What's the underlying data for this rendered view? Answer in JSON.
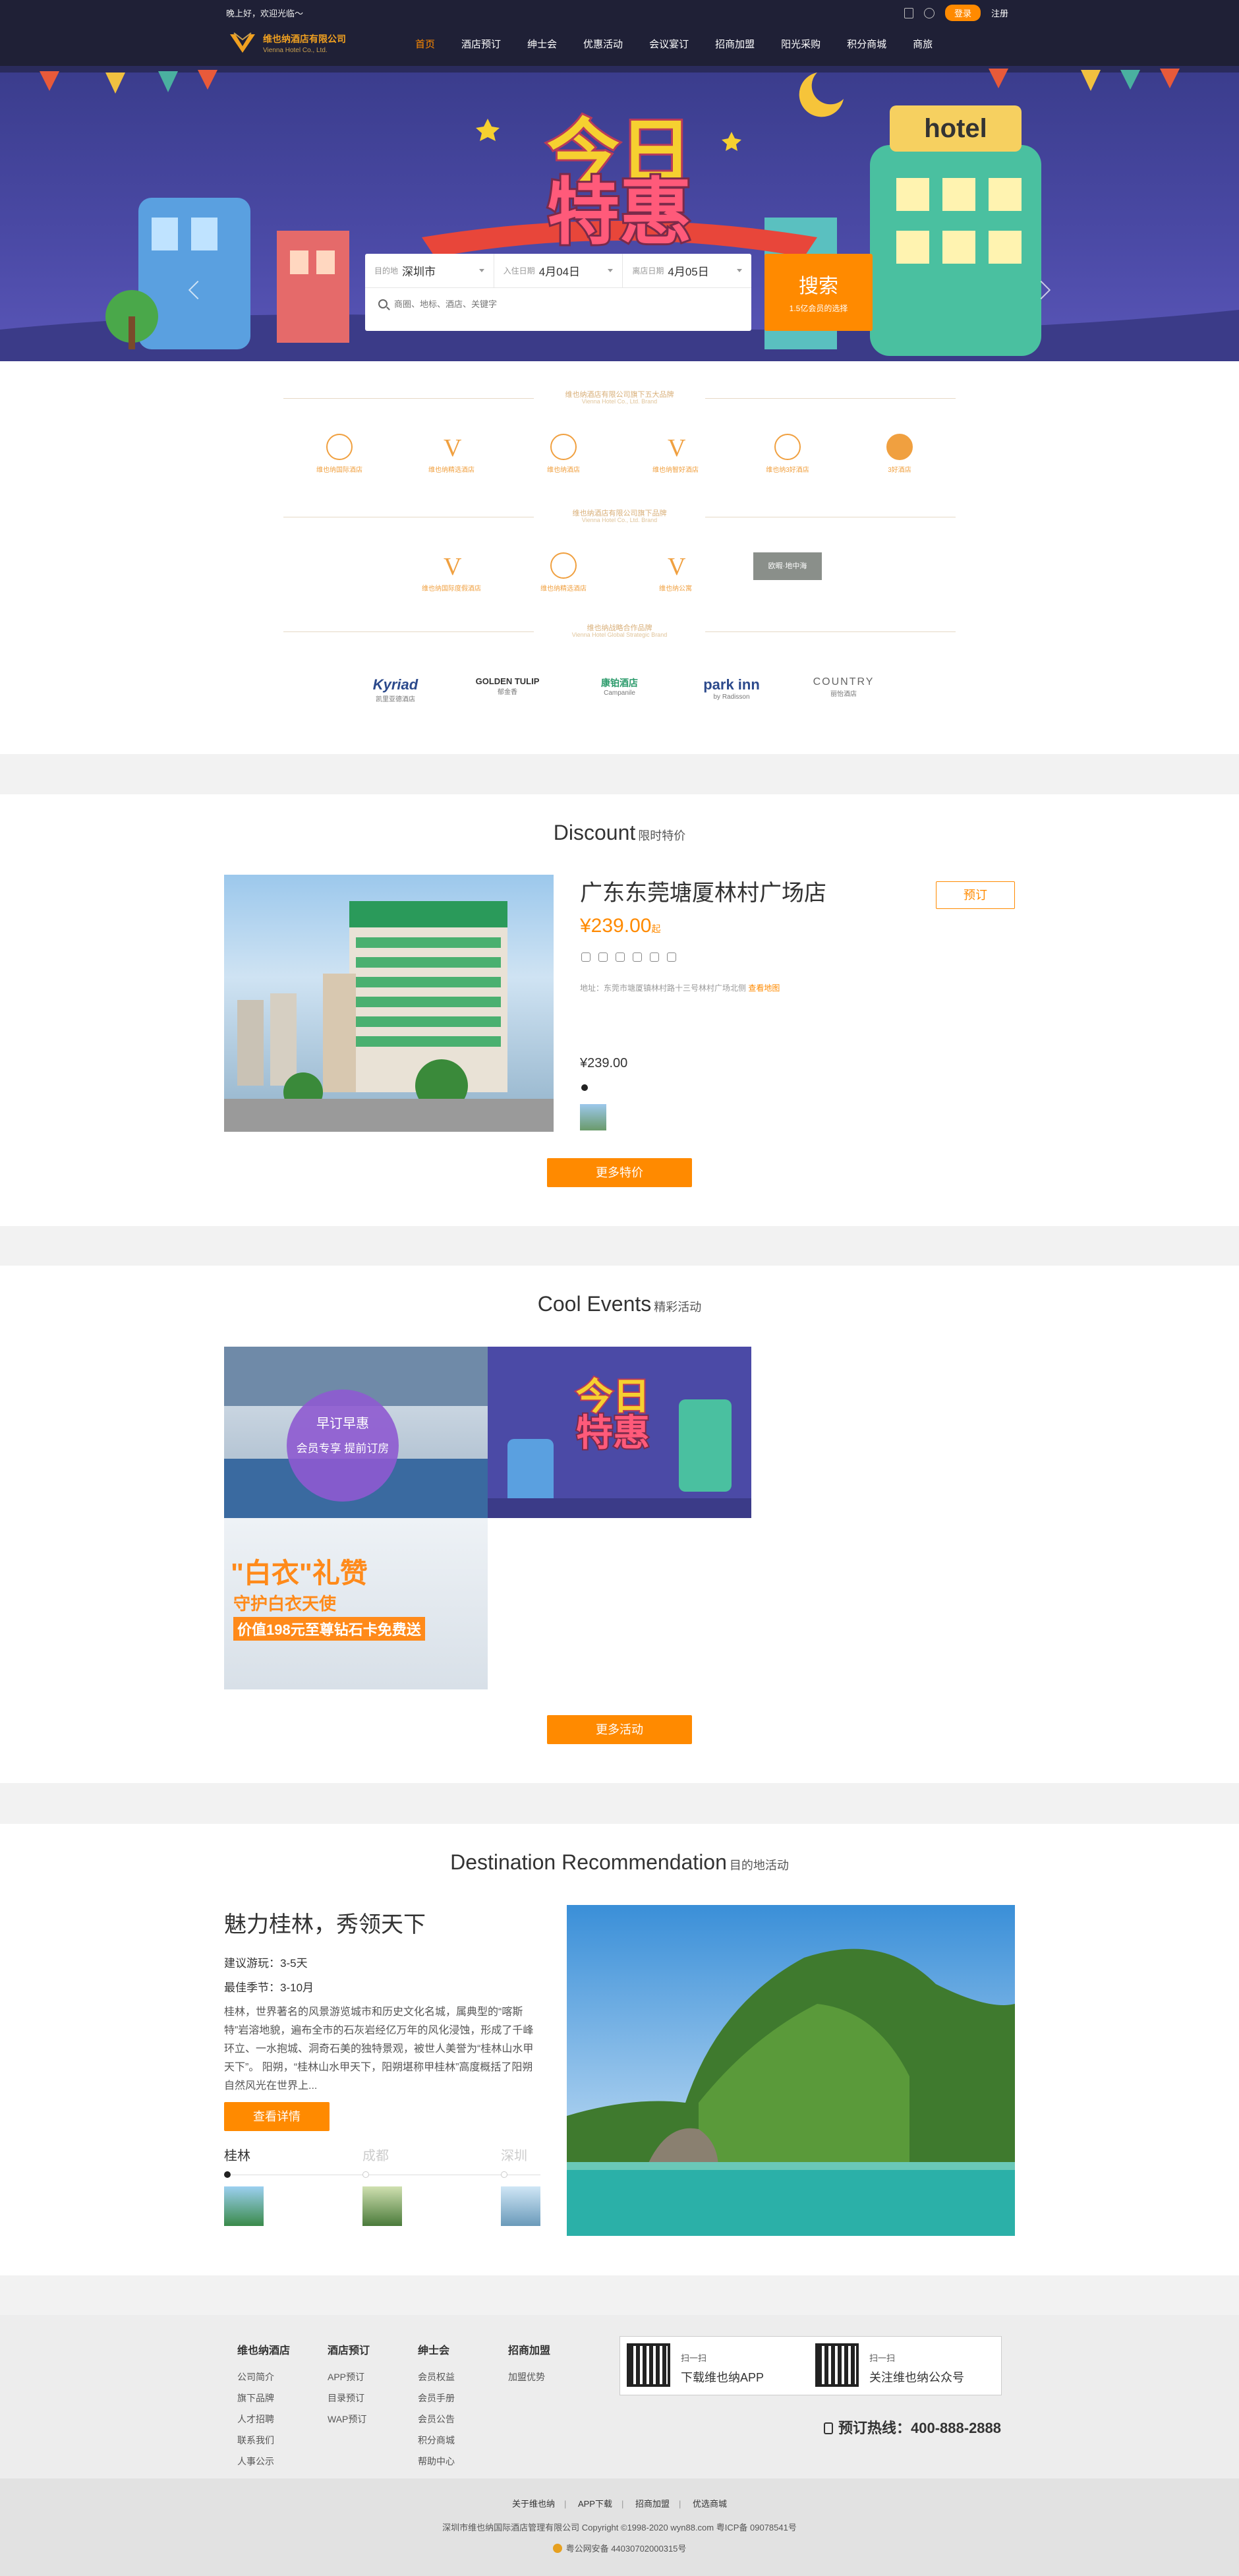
{
  "topbar": {
    "welcome": "晚上好，欢迎光临～",
    "login": "登录",
    "register": "注册"
  },
  "logo": {
    "cn": "维也纳酒店有限公司",
    "en": "Vienna Hotel Co., Ltd."
  },
  "nav": [
    "首页",
    "酒店预订",
    "绅士会",
    "优惠活动",
    "会议宴订",
    "招商加盟",
    "阳光采购",
    "积分商城",
    "商旅"
  ],
  "search": {
    "dest_label": "目的地",
    "dest_value": "深圳市",
    "checkin_label": "入住日期",
    "checkin_value": "4月04日",
    "checkout_label": "离店日期",
    "checkout_value": "4月05日",
    "keyword_placeholder": "商圈、地标、酒店、关键字",
    "button": "搜索",
    "button_sub": "1.5亿会员的选择"
  },
  "brands": {
    "group1_title": "维也纳酒店有限公司旗下五大品牌",
    "group1_en": "Vienna Hotel Co., Ltd. Brand",
    "group1": [
      "维也纳国际酒店",
      "维也纳精选酒店",
      "维也纳酒店",
      "维也纳智好酒店",
      "维也纳3好酒店",
      "3好酒店"
    ],
    "group2_title": "维也纳酒店有限公司旗下品牌",
    "group2_en": "Vienna Hotel Co., Ltd. Brand",
    "group2": [
      "维也纳国际度假酒店",
      "维也纳精选酒店",
      "维也纳公寓"
    ],
    "group2_gray": "欧暇·地中海",
    "group3_title": "维也纳战略合作品牌",
    "group3_en": "Vienna Hotel Global Strategic Brand",
    "partners": [
      {
        "name": "Kyriad",
        "sub": "凯里亚德酒店"
      },
      {
        "name": "GOLDEN TULIP",
        "sub": "郁金香"
      },
      {
        "name": "康铂酒店",
        "sub": "Campanile"
      },
      {
        "name": "park inn",
        "sub": "by Radisson"
      },
      {
        "name": "COUNTRY",
        "sub": "丽怡酒店"
      }
    ]
  },
  "discount": {
    "title_en": "Discount",
    "title_cn": "限时特价",
    "hotel_name": "广东东莞塘厦林村广场店",
    "book": "预订",
    "price": "¥239.00",
    "price_suffix": "起",
    "address": "地址：东莞市塘厦镇林村路十三号林村广场北侧",
    "map_link": "查看地图",
    "small_price": "¥239.00",
    "more": "更多特价"
  },
  "events": {
    "title_en": "Cool Events",
    "title_cn": "精彩活动",
    "ev1_line1": "早订早惠",
    "ev1_line2": "会员专享 提前订房",
    "ev3_line1": "\"白衣\"礼赞",
    "ev3_line2": "守护白衣天使",
    "ev3_line3": "价值198元至尊钻石卡免费送",
    "more": "更多活动"
  },
  "destination": {
    "title_en": "Destination Recommendation",
    "title_cn": "目的地活动",
    "name": "魅力桂林，秀领天下",
    "days": "建议游玩：3-5天",
    "season": "最佳季节：3-10月",
    "desc": "桂林，世界著名的风景游览城市和历史文化名城，属典型的“喀斯特”岩溶地貌，遍布全市的石灰岩经亿万年的风化浸蚀，形成了千峰环立、一水抱城、洞奇石美的独特景观，被世人美誉为“桂林山水甲天下”。 阳朔，“桂林山水甲天下，阳朔堪称甲桂林”高度概括了阳朔自然风光在世界上...",
    "details": "查看详情",
    "tabs": [
      "桂林",
      "成都",
      "深圳"
    ]
  },
  "footer": {
    "cols": [
      {
        "head": "维也纳酒店",
        "links": [
          "公司简介",
          "旗下品牌",
          "人才招聘",
          "联系我们",
          "人事公示"
        ]
      },
      {
        "head": "酒店预订",
        "links": [
          "APP预订",
          "目录预订",
          "WAP预订"
        ]
      },
      {
        "head": "绅士会",
        "links": [
          "会员权益",
          "会员手册",
          "会员公告",
          "积分商城",
          "帮助中心"
        ]
      },
      {
        "head": "招商加盟",
        "links": [
          "加盟优势"
        ]
      }
    ],
    "qr1_top": "扫一扫",
    "qr1_text": "下载维也纳APP",
    "qr2_top": "扫一扫",
    "qr2_text": "关注维也纳公众号",
    "hotline": "预订热线：400-888-2888",
    "bottom_links": [
      "关于维也纳",
      "APP下载",
      "招商加盟",
      "优选商城"
    ],
    "copyright": "深圳市维也纳国际酒店管理有限公司   Copyright ©1998-2020   wyn88.com   粤ICP备 09078541号",
    "police": "粤公网安备 44030702000315号"
  },
  "colors": {
    "accent": "#ff8a00",
    "dark": "#1f2036",
    "banner": "#4b4aa6"
  }
}
